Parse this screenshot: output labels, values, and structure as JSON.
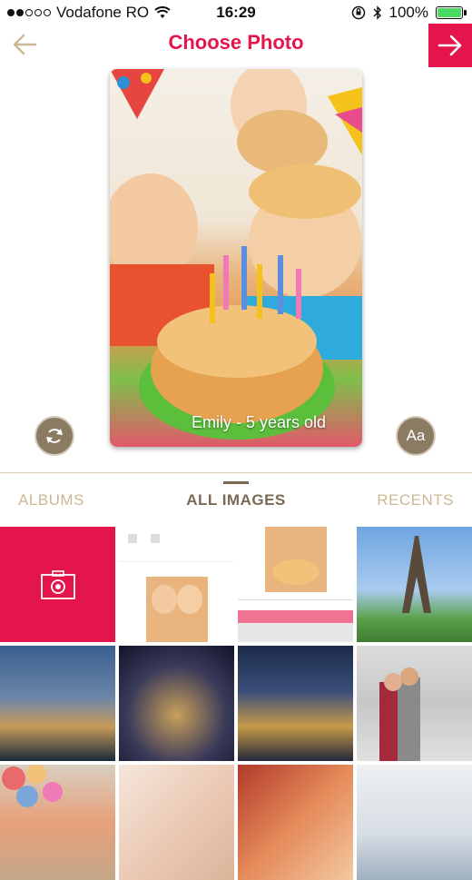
{
  "status_bar": {
    "carrier": "Vodafone RO",
    "time": "16:29",
    "battery": "100%"
  },
  "header": {
    "title": "Choose Photo"
  },
  "preview": {
    "caption": "Emily - 5 years old"
  },
  "controls": {
    "text_button": "Aa"
  },
  "tabs": [
    {
      "label": "ALBUMS"
    },
    {
      "label": "ALL IMAGES"
    },
    {
      "label": "RECENTS"
    }
  ],
  "colors": {
    "accent": "#e4154b",
    "gold": "#cdb893",
    "brown": "#7a6a52"
  }
}
